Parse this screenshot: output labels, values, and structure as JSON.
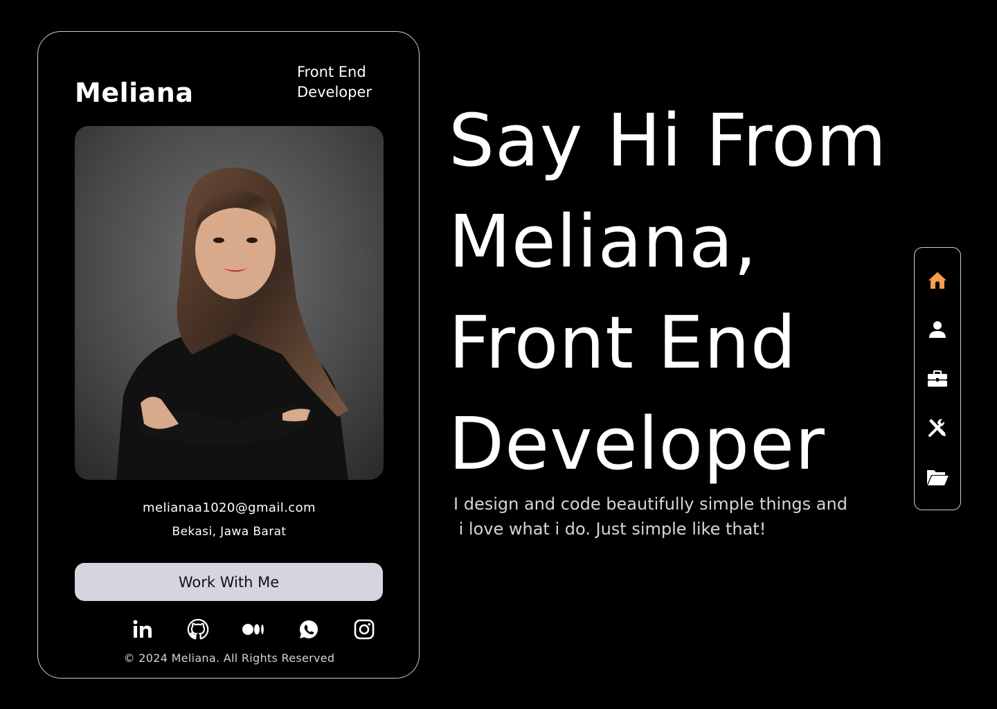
{
  "card": {
    "name": "Meliana",
    "role_line1": "Front End",
    "role_line2": "Developer",
    "email": "melianaa1020@gmail.com",
    "location": "Bekasi, Jawa Barat",
    "cta_label": "Work With Me",
    "copyright": "© 2024 Meliana. All Rights Reserved",
    "socials": [
      {
        "icon": "linkedin-icon"
      },
      {
        "icon": "github-icon"
      },
      {
        "icon": "medium-icon"
      },
      {
        "icon": "whatsapp-icon"
      },
      {
        "icon": "instagram-icon"
      }
    ]
  },
  "hero": {
    "title_lines": [
      "Say Hi From",
      "Meliana,",
      "Front End",
      "Developer"
    ],
    "description_lines": [
      "I design and code beautifully simple things and",
      " i love what i do. Just simple like that!"
    ]
  },
  "nav": {
    "items": [
      {
        "icon": "home-icon",
        "active": true
      },
      {
        "icon": "user-icon",
        "active": false
      },
      {
        "icon": "briefcase-icon",
        "active": false
      },
      {
        "icon": "tools-icon",
        "active": false
      },
      {
        "icon": "folder-icon",
        "active": false
      }
    ]
  },
  "colors": {
    "background": "#000000",
    "text": "#ffffff",
    "accent_active": "#f5a04a",
    "button_bg": "#d8d4df",
    "border": "#cfcfcf"
  }
}
